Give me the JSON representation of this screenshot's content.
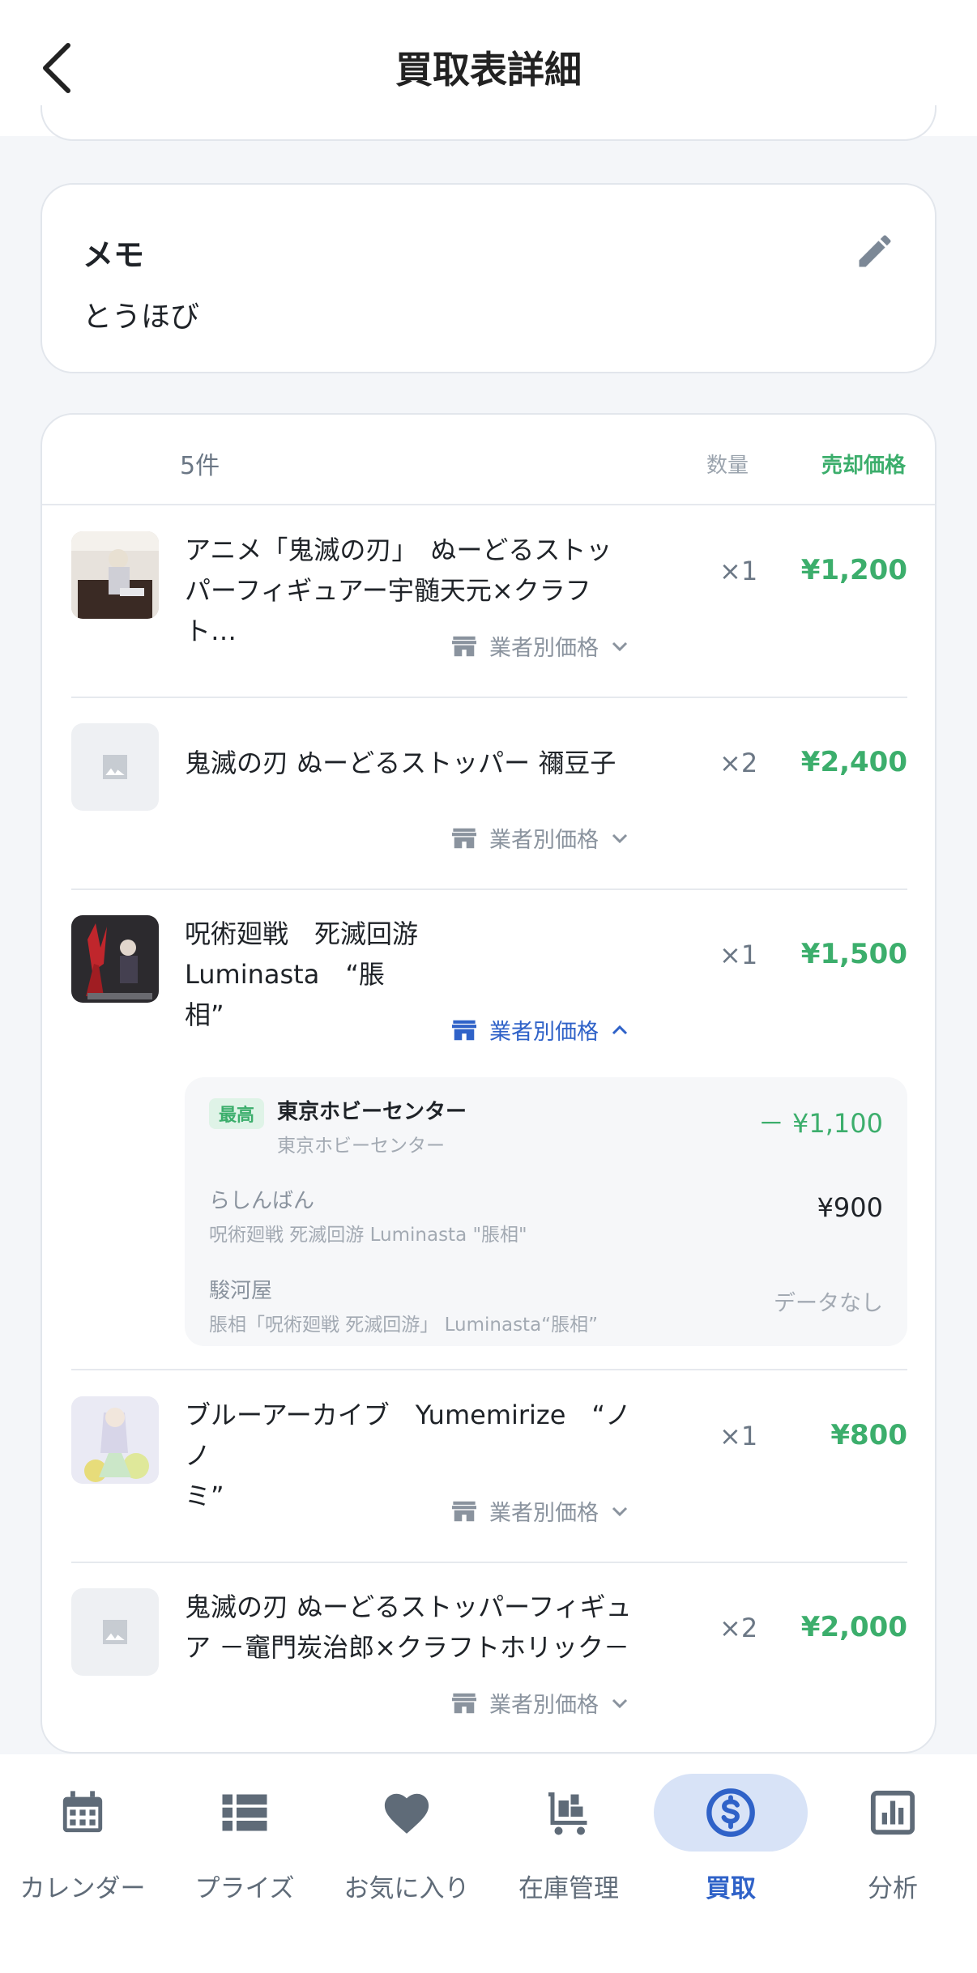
{
  "header": {
    "title": "買取表詳細"
  },
  "memo": {
    "title": "メモ",
    "text": "とうほび"
  },
  "list": {
    "count_label": "5件",
    "qty_header": "数量",
    "price_header": "売却価格",
    "vendor_label": "業者別価格",
    "items": [
      {
        "name_line1": "アニメ「鬼滅の刃」　ぬーどるストッ",
        "name_line2": "パーフィギュアー宇髄天元×クラフト…",
        "qty": "×1",
        "price": "¥1,200"
      },
      {
        "name_line1": "鬼滅の刃 ぬーどるストッパー 禰豆子",
        "name_line2": "",
        "qty": "×2",
        "price": "¥2,400"
      },
      {
        "name_line1": "呪術廻戦　死滅回游　Luminasta　“脹",
        "name_line2": "相”",
        "qty": "×1",
        "price": "¥1,500"
      },
      {
        "name_line1": "ブルーアーカイブ　Yumemirize　“ノノ",
        "name_line2": "ミ”",
        "qty": "×1",
        "price": "¥800"
      },
      {
        "name_line1": "鬼滅の刃 ぬーどるストッパーフィギュ",
        "name_line2": "ア －竈門炭治郎×クラフトホリック－",
        "qty": "×2",
        "price": "¥2,000"
      }
    ],
    "vendors": [
      {
        "badge": "最高",
        "name": "東京ホビーセンター",
        "sub": "東京ホビーセンター",
        "price": "－ ¥1,100"
      },
      {
        "name": "らしんばん",
        "sub": "呪術廻戦 死滅回游 Luminasta \"脹相\"",
        "price": "¥900"
      },
      {
        "name": "駿河屋",
        "sub": "脹相「呪術廻戦 死滅回游」 Luminasta“脹相”",
        "price": "データなし"
      }
    ]
  },
  "tabs": [
    {
      "label": "カレンダー",
      "icon": "calendar-icon"
    },
    {
      "label": "プライズ",
      "icon": "list-icon"
    },
    {
      "label": "お気に入り",
      "icon": "heart-icon"
    },
    {
      "label": "在庫管理",
      "icon": "cart-icon"
    },
    {
      "label": "買取",
      "icon": "dollar-icon",
      "active": true
    },
    {
      "label": "分析",
      "icon": "chart-icon"
    }
  ],
  "colors": {
    "accent_green": "#3cae6c",
    "accent_blue": "#2f62c8",
    "active_tab_bg": "#d8e3f7"
  }
}
